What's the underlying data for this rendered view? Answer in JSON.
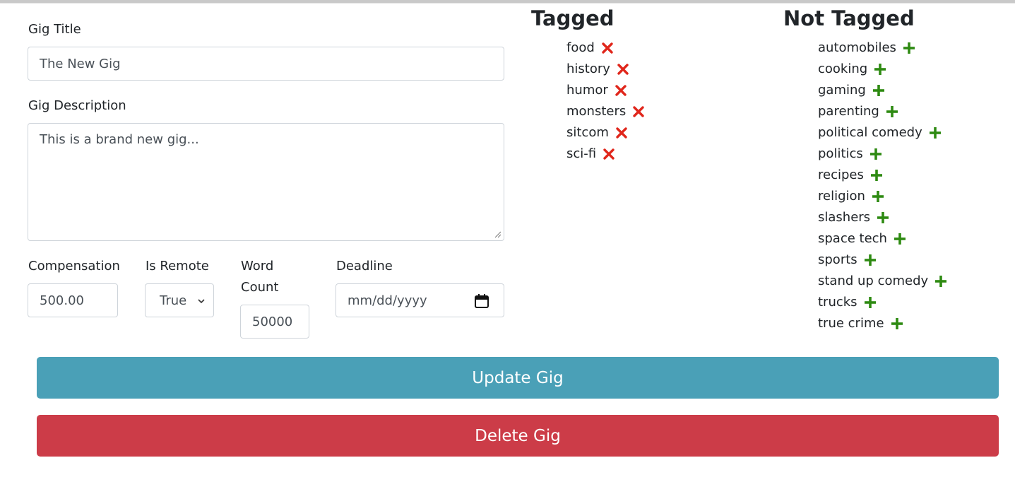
{
  "form": {
    "title_label": "Gig Title",
    "title_value": "The New Gig",
    "description_label": "Gig Description",
    "description_value": "This is a brand new gig...",
    "compensation_label": "Compensation",
    "compensation_value": "500.00",
    "remote_label": "Is Remote",
    "remote_value": "True",
    "word_count_label_line1": "Word",
    "word_count_label_line2": "Count",
    "word_count_value": "50000",
    "deadline_label": "Deadline",
    "deadline_value": "mm/dd/yyyy"
  },
  "tagged": {
    "heading": "Tagged",
    "icon": "remove-x-icon",
    "color": "#e0261b",
    "items": [
      "food",
      "history",
      "humor",
      "monsters",
      "sitcom",
      "sci-fi"
    ]
  },
  "not_tagged": {
    "heading": "Not Tagged",
    "icon": "add-plus-icon",
    "color": "#2e8a12",
    "items": [
      "automobiles",
      "cooking",
      "gaming",
      "parenting",
      "political comedy",
      "politics",
      "recipes",
      "religion",
      "slashers",
      "space tech",
      "sports",
      "stand up comedy",
      "trucks",
      "true crime"
    ]
  },
  "buttons": {
    "update_label": "Update Gig",
    "delete_label": "Delete Gig",
    "update_color": "#4aa0b7",
    "delete_color": "#cc3c48"
  }
}
